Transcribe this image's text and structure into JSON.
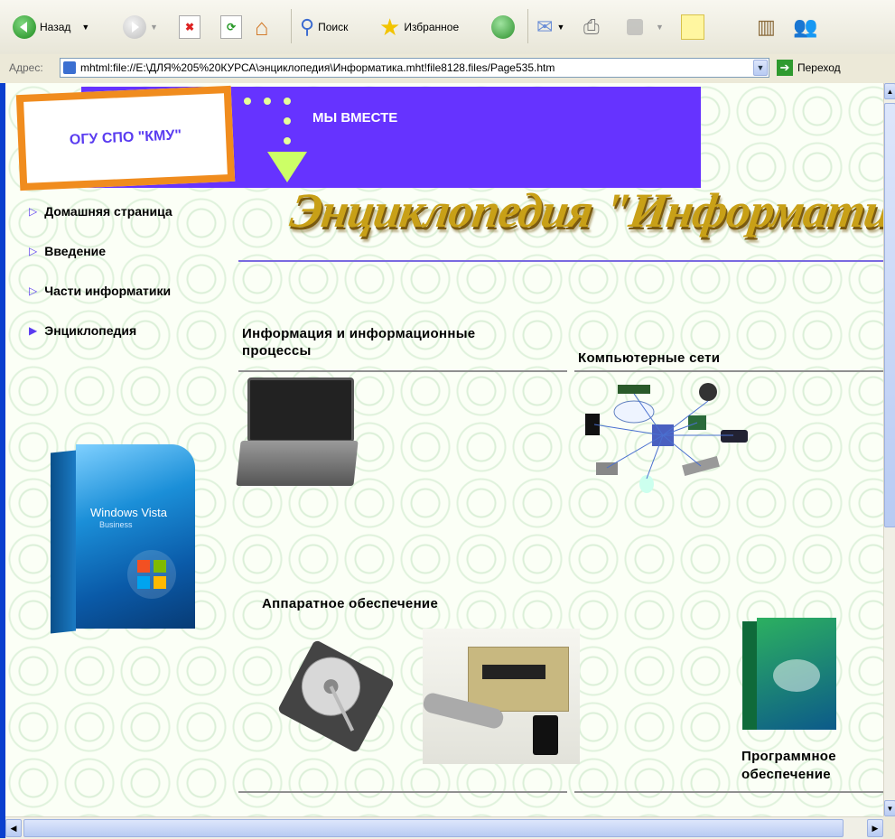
{
  "toolbar": {
    "back_label": "Назад",
    "search_label": "Поиск",
    "favorites_label": "Избранное"
  },
  "address": {
    "label": "Адрес:",
    "url": "mhtml:file://E:\\ДЛЯ%205%20КУРСА\\энциклопедия\\Информатика.mht!file8128.files/Page535.htm",
    "go_label": "Переход"
  },
  "site": {
    "logo_text": "ОГУ СПО \"КМУ\"",
    "banner_text": "МЫ ВМЕСТЕ",
    "title": "Энциклопедия \"Информатика\""
  },
  "nav": {
    "items": [
      {
        "label": "Домашняя страница",
        "active": false
      },
      {
        "label": "Введение",
        "active": false
      },
      {
        "label": "Части информатики",
        "active": false
      },
      {
        "label": "Энциклопедия",
        "active": true
      }
    ]
  },
  "product_box": {
    "brand": "Windows Vista",
    "edition": "Business"
  },
  "sections": {
    "info": "Информация и информационные процессы",
    "networks": "Компьютерные сети",
    "hardware": "Аппаратное обеспечение",
    "software": "Программное обеспечение"
  },
  "colors": {
    "banner": "#6633ff",
    "logo_border": "#f08c1e",
    "accent": "#5a3cf0"
  }
}
